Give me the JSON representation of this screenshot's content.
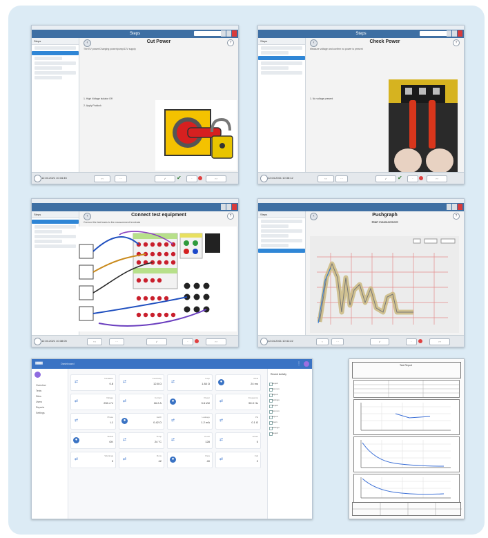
{
  "shot1": {
    "window_title": "Steps",
    "title": "Cut Power",
    "description": "The EV power/Charging power/pump/12V supply",
    "lines": [
      "1. High Voltage Isolator Off",
      "2. Apply Padlock"
    ],
    "timestamp": "12.04.2021 10:34:45"
  },
  "shot2": {
    "window_title": "Steps",
    "title": "Check Power",
    "description": "Measure voltage and confirm no power is present",
    "lines": [
      "1. No voltage present"
    ],
    "timestamp": "12.04.2021 10:36:12"
  },
  "shot3": {
    "title": "Connect test equipment",
    "description": "Connect the test leads to the measurement terminals",
    "timestamp": "12.04.2021 10:38:05"
  },
  "shot4": {
    "title": "Pushgraph",
    "subtitle": "Start measurement",
    "timestamp": "12.04.2021 10:41:22"
  },
  "dashboard": {
    "app_title": "Dashboard",
    "nav": [
      "Overview",
      "Tests",
      "Sites",
      "Users",
      "Reports",
      "Settings"
    ],
    "right_heading": "Recent Activity",
    "right_items": [
      "Report",
      "Test run",
      "Export",
      "Settings",
      "Report",
      "Test run",
      "Export",
      "Users",
      "Settings",
      "Report"
    ],
    "tiles": [
      {
        "label": "Insulation",
        "value": "0.8"
      },
      {
        "label": "Continuity",
        "value": "12.8 Ω"
      },
      {
        "label": "Loop",
        "value": "1.84 Ω"
      },
      {
        "label": "RCD",
        "value": "24 ms"
      },
      {
        "label": "Voltage",
        "value": "230.4 V"
      },
      {
        "label": "Current",
        "value": "16.2 A"
      },
      {
        "label": "Power",
        "value": "3.6 kW"
      },
      {
        "label": "Frequency",
        "value": "50.0 Hz"
      },
      {
        "label": "Phase",
        "value": "L1"
      },
      {
        "label": "Earth",
        "value": "0.42 Ω"
      },
      {
        "label": "Leakage",
        "value": "1.2 mA"
      },
      {
        "label": "PE",
        "value": "0.1 Ω"
      },
      {
        "label": "Status",
        "value": "OK"
      },
      {
        "label": "Temp",
        "value": "24 °C"
      },
      {
        "label": "Count",
        "value": "128"
      },
      {
        "label": "Errors",
        "value": "0"
      },
      {
        "label": "Warnings",
        "value": "3"
      },
      {
        "label": "Runs",
        "value": "42"
      },
      {
        "label": "Pass",
        "value": "40"
      },
      {
        "label": "Fail",
        "value": "2"
      }
    ]
  },
  "report": {
    "title": "Test Report"
  }
}
